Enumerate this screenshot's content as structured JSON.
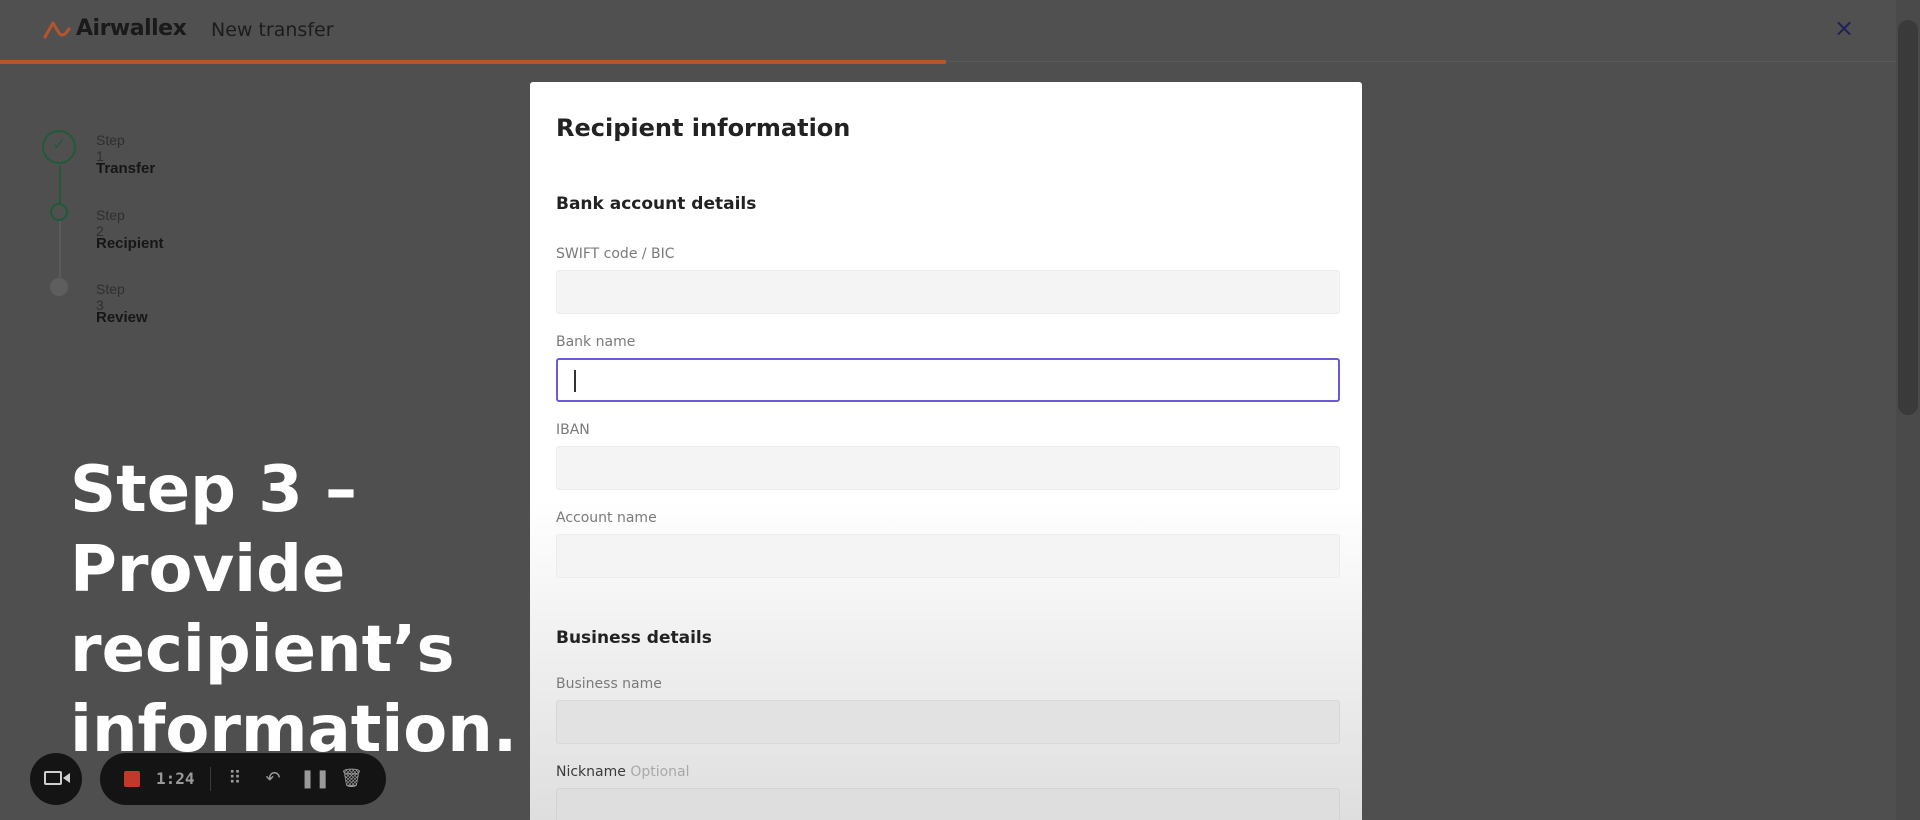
{
  "header": {
    "brand": "Airwallex",
    "title": "New transfer",
    "close_glyph": "×",
    "accent_color": "#b5542d"
  },
  "stepper": {
    "steps": [
      {
        "label": "Step 1",
        "name": "Transfer",
        "status": "complete"
      },
      {
        "label": "Step 2",
        "name": "Recipient",
        "status": "current"
      },
      {
        "label": "Step 3",
        "name": "Review",
        "status": "upcoming"
      }
    ]
  },
  "modal": {
    "title": "Recipient information",
    "bank_section": {
      "title": "Bank account details",
      "fields": [
        {
          "label": "SWIFT code / BIC",
          "value": ""
        },
        {
          "label": "Bank name",
          "value": "",
          "focused": true
        },
        {
          "label": "IBAN",
          "value": ""
        },
        {
          "label": "Account name",
          "value": ""
        }
      ]
    },
    "business_section": {
      "title": "Business details",
      "fields": [
        {
          "label": "Business name",
          "value": ""
        },
        {
          "label": "Nickname",
          "optional_text": "Optional",
          "value": ""
        }
      ]
    },
    "focus_color": "#6a5ad6"
  },
  "caption": {
    "lines": [
      "Step 3 –",
      "Provide",
      "recipient’s",
      "information."
    ]
  },
  "recorder": {
    "time": "1:24",
    "icons": [
      "camera-icon",
      "stop-icon",
      "grid-icon",
      "undo-icon",
      "pause-icon",
      "trash-icon"
    ]
  }
}
